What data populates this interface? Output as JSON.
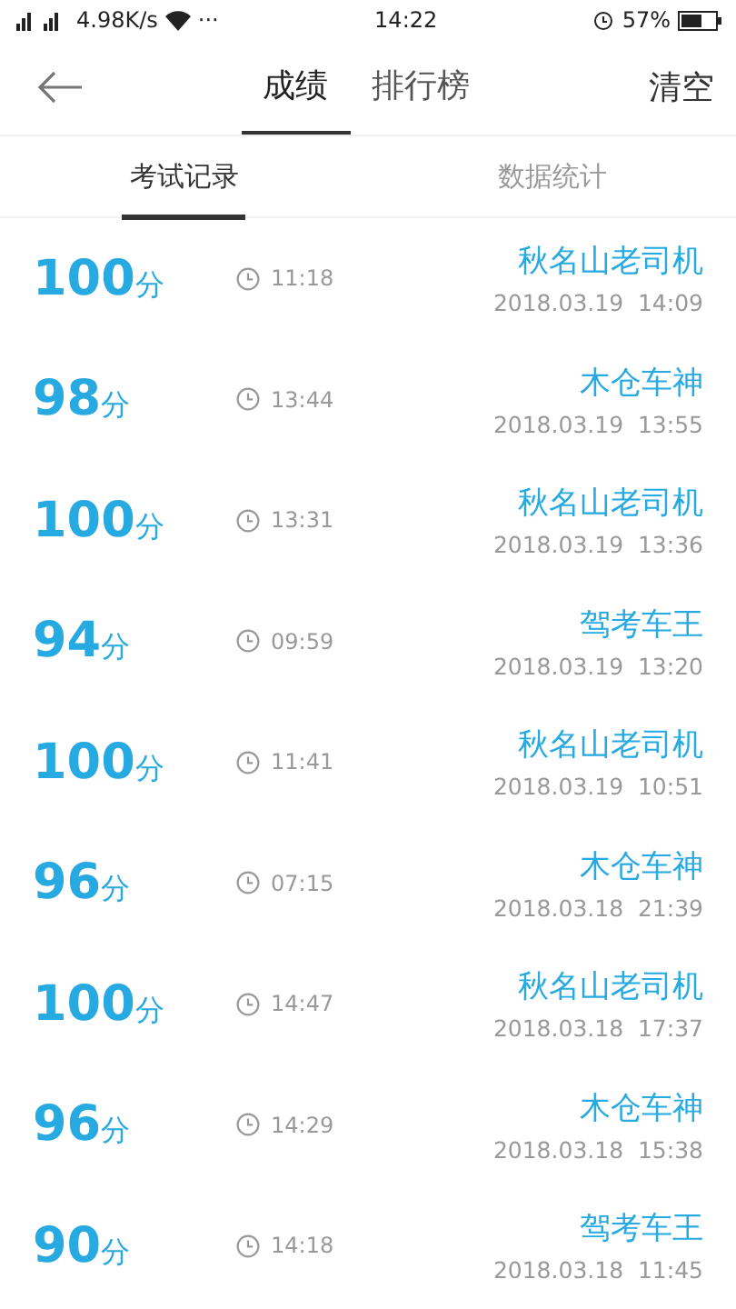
{
  "status_bar": {
    "speed": "4.98K/s",
    "more": "···",
    "time": "14:22",
    "battery": "57%"
  },
  "header": {
    "tabs": [
      {
        "label": "成绩",
        "selected": true
      },
      {
        "label": "排行榜",
        "selected": false
      }
    ],
    "action": "清空"
  },
  "subtabs": [
    {
      "label": "考试记录",
      "selected": true
    },
    {
      "label": "数据统计",
      "selected": false
    }
  ],
  "records": [
    {
      "score": "100",
      "unit": "分",
      "duration": "11:18",
      "name": "秋名山老司机",
      "date": "2018.03.19  14:09"
    },
    {
      "score": "98",
      "unit": "分",
      "duration": "13:44",
      "name": "木仓车神",
      "date": "2018.03.19  13:55"
    },
    {
      "score": "100",
      "unit": "分",
      "duration": "13:31",
      "name": "秋名山老司机",
      "date": "2018.03.19  13:36"
    },
    {
      "score": "94",
      "unit": "分",
      "duration": "09:59",
      "name": "驾考车王",
      "date": "2018.03.19  13:20"
    },
    {
      "score": "100",
      "unit": "分",
      "duration": "11:41",
      "name": "秋名山老司机",
      "date": "2018.03.19  10:51"
    },
    {
      "score": "96",
      "unit": "分",
      "duration": "07:15",
      "name": "木仓车神",
      "date": "2018.03.18  21:39"
    },
    {
      "score": "100",
      "unit": "分",
      "duration": "14:47",
      "name": "秋名山老司机",
      "date": "2018.03.18  17:37"
    },
    {
      "score": "96",
      "unit": "分",
      "duration": "14:29",
      "name": "木仓车神",
      "date": "2018.03.18  15:38"
    },
    {
      "score": "90",
      "unit": "分",
      "duration": "14:18",
      "name": "驾考车王",
      "date": "2018.03.18  11:45"
    }
  ]
}
